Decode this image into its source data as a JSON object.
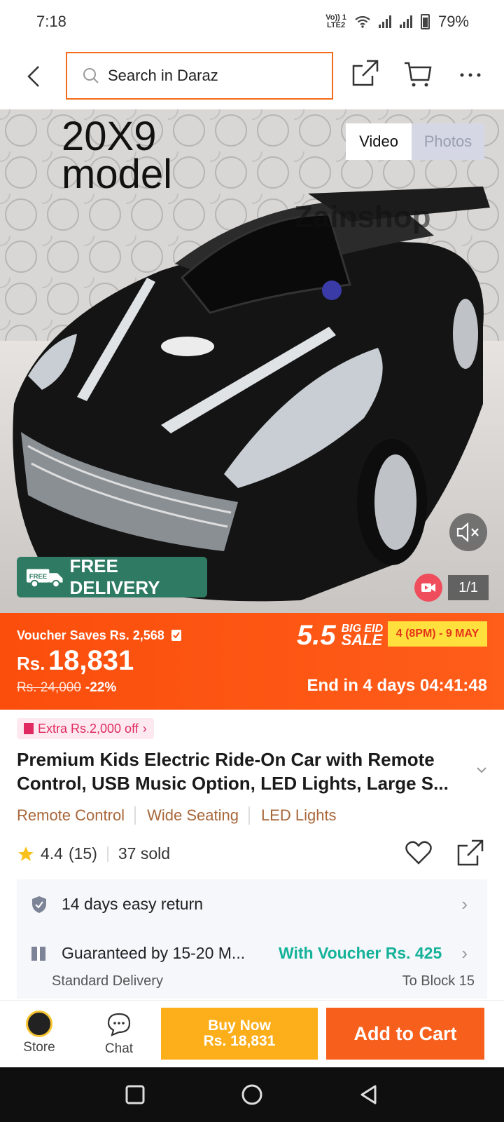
{
  "status": {
    "time": "7:18",
    "net_top": "Vo)) 1",
    "net_bottom": "LTE2",
    "battery": "79%"
  },
  "search": {
    "placeholder": "Search in Daraz"
  },
  "hero": {
    "model_line1": "20X9",
    "model_line2": "model",
    "video_label": "Video",
    "photos_label": "Photos",
    "free_delivery": "FREE DELIVERY",
    "free_tag": "FREE",
    "counter": "1/1"
  },
  "price": {
    "voucher_saves": "Voucher Saves Rs. 2,568",
    "currency": "Rs.",
    "amount": "18,831",
    "old_price": "Rs. 24,000",
    "discount": "-22%",
    "sale_number": "5.5",
    "sale_word1": "BIG EID",
    "sale_word2": "SALE",
    "sale_dates": "4 (8PM) - 9 MAY",
    "countdown": "End in 4 days 04:41:48"
  },
  "product": {
    "extra_off": "Extra Rs.2,000 off",
    "title": "Premium Kids Electric Ride-On Car with Remote Control, USB Music Option, LED Lights, Large S...",
    "tags": [
      "Remote Control",
      "Wide Seating",
      "LED Lights"
    ],
    "rating": "4.4",
    "reviews": "(15)",
    "sold": "37 sold"
  },
  "service": {
    "return": "14 days easy return",
    "delivery": "Guaranteed by 15-20 M...",
    "voucher": "With Voucher Rs. 425",
    "delivery_type": "Standard Delivery",
    "destination": "To Block 15"
  },
  "actions": {
    "store": "Store",
    "chat": "Chat",
    "buy_now": "Buy Now",
    "buy_price": "Rs. 18,831",
    "add_to_cart": "Add to Cart"
  },
  "colors": {
    "accent": "#f75f1d",
    "buy_now": "#fcae1b",
    "voucher_green": "#15b29a",
    "tag_brown": "#a8673a"
  }
}
